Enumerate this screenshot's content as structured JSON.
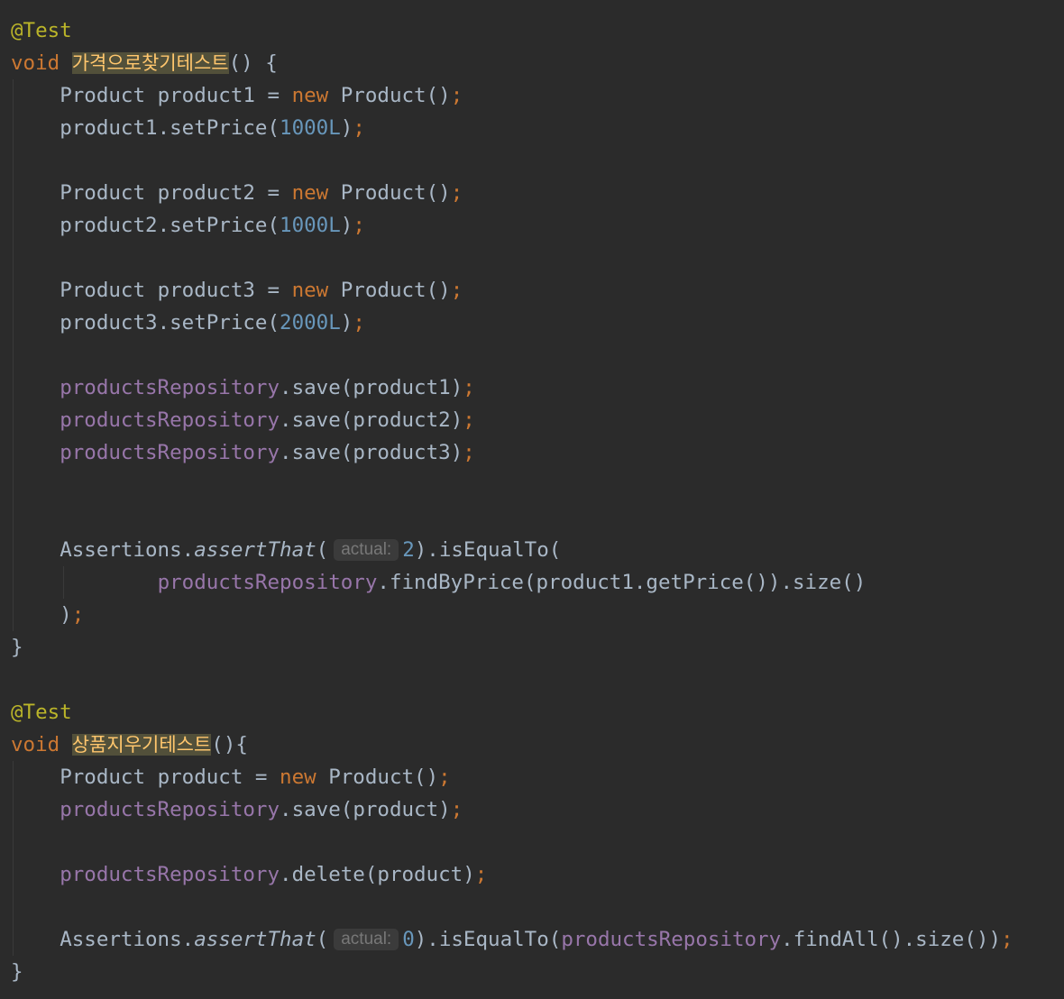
{
  "code": {
    "annotation": "@Test",
    "kw_void": "void",
    "kw_new": "new",
    "test1_name": "가격으로찾기테스트",
    "test2_name": "상품지우기테스트",
    "type_product": "Product",
    "var_product1": "product1",
    "var_product2": "product2",
    "var_product3": "product3",
    "var_product": "product",
    "repo": "productsRepository",
    "assertions": "Assertions",
    "assert_that": "assertThat",
    "hint_actual": "actual:",
    "n_1000": "1000L",
    "n_2000": "2000L",
    "n_2": "2",
    "n_0": "0"
  }
}
